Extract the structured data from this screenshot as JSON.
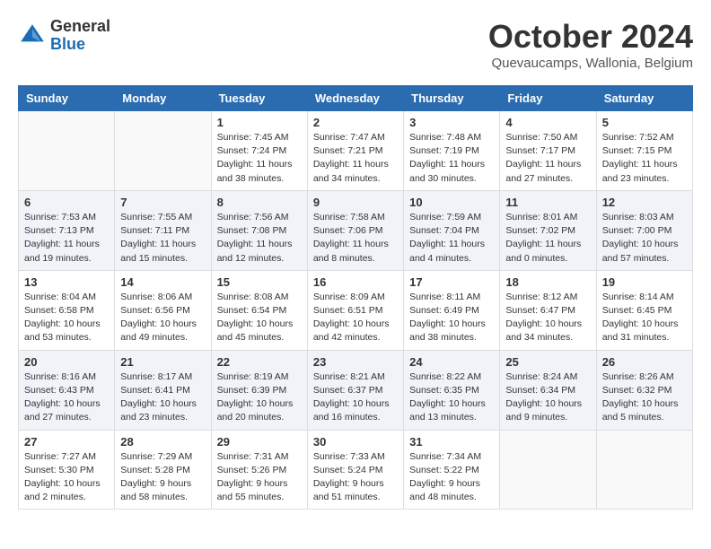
{
  "header": {
    "logo_general": "General",
    "logo_blue": "Blue",
    "month_title": "October 2024",
    "location": "Quevaucamps, Wallonia, Belgium"
  },
  "weekdays": [
    "Sunday",
    "Monday",
    "Tuesday",
    "Wednesday",
    "Thursday",
    "Friday",
    "Saturday"
  ],
  "weeks": [
    {
      "days": [
        {
          "num": "",
          "info": ""
        },
        {
          "num": "",
          "info": ""
        },
        {
          "num": "1",
          "info": "Sunrise: 7:45 AM\nSunset: 7:24 PM\nDaylight: 11 hours and 38 minutes."
        },
        {
          "num": "2",
          "info": "Sunrise: 7:47 AM\nSunset: 7:21 PM\nDaylight: 11 hours and 34 minutes."
        },
        {
          "num": "3",
          "info": "Sunrise: 7:48 AM\nSunset: 7:19 PM\nDaylight: 11 hours and 30 minutes."
        },
        {
          "num": "4",
          "info": "Sunrise: 7:50 AM\nSunset: 7:17 PM\nDaylight: 11 hours and 27 minutes."
        },
        {
          "num": "5",
          "info": "Sunrise: 7:52 AM\nSunset: 7:15 PM\nDaylight: 11 hours and 23 minutes."
        }
      ]
    },
    {
      "days": [
        {
          "num": "6",
          "info": "Sunrise: 7:53 AM\nSunset: 7:13 PM\nDaylight: 11 hours and 19 minutes."
        },
        {
          "num": "7",
          "info": "Sunrise: 7:55 AM\nSunset: 7:11 PM\nDaylight: 11 hours and 15 minutes."
        },
        {
          "num": "8",
          "info": "Sunrise: 7:56 AM\nSunset: 7:08 PM\nDaylight: 11 hours and 12 minutes."
        },
        {
          "num": "9",
          "info": "Sunrise: 7:58 AM\nSunset: 7:06 PM\nDaylight: 11 hours and 8 minutes."
        },
        {
          "num": "10",
          "info": "Sunrise: 7:59 AM\nSunset: 7:04 PM\nDaylight: 11 hours and 4 minutes."
        },
        {
          "num": "11",
          "info": "Sunrise: 8:01 AM\nSunset: 7:02 PM\nDaylight: 11 hours and 0 minutes."
        },
        {
          "num": "12",
          "info": "Sunrise: 8:03 AM\nSunset: 7:00 PM\nDaylight: 10 hours and 57 minutes."
        }
      ]
    },
    {
      "days": [
        {
          "num": "13",
          "info": "Sunrise: 8:04 AM\nSunset: 6:58 PM\nDaylight: 10 hours and 53 minutes."
        },
        {
          "num": "14",
          "info": "Sunrise: 8:06 AM\nSunset: 6:56 PM\nDaylight: 10 hours and 49 minutes."
        },
        {
          "num": "15",
          "info": "Sunrise: 8:08 AM\nSunset: 6:54 PM\nDaylight: 10 hours and 45 minutes."
        },
        {
          "num": "16",
          "info": "Sunrise: 8:09 AM\nSunset: 6:51 PM\nDaylight: 10 hours and 42 minutes."
        },
        {
          "num": "17",
          "info": "Sunrise: 8:11 AM\nSunset: 6:49 PM\nDaylight: 10 hours and 38 minutes."
        },
        {
          "num": "18",
          "info": "Sunrise: 8:12 AM\nSunset: 6:47 PM\nDaylight: 10 hours and 34 minutes."
        },
        {
          "num": "19",
          "info": "Sunrise: 8:14 AM\nSunset: 6:45 PM\nDaylight: 10 hours and 31 minutes."
        }
      ]
    },
    {
      "days": [
        {
          "num": "20",
          "info": "Sunrise: 8:16 AM\nSunset: 6:43 PM\nDaylight: 10 hours and 27 minutes."
        },
        {
          "num": "21",
          "info": "Sunrise: 8:17 AM\nSunset: 6:41 PM\nDaylight: 10 hours and 23 minutes."
        },
        {
          "num": "22",
          "info": "Sunrise: 8:19 AM\nSunset: 6:39 PM\nDaylight: 10 hours and 20 minutes."
        },
        {
          "num": "23",
          "info": "Sunrise: 8:21 AM\nSunset: 6:37 PM\nDaylight: 10 hours and 16 minutes."
        },
        {
          "num": "24",
          "info": "Sunrise: 8:22 AM\nSunset: 6:35 PM\nDaylight: 10 hours and 13 minutes."
        },
        {
          "num": "25",
          "info": "Sunrise: 8:24 AM\nSunset: 6:34 PM\nDaylight: 10 hours and 9 minutes."
        },
        {
          "num": "26",
          "info": "Sunrise: 8:26 AM\nSunset: 6:32 PM\nDaylight: 10 hours and 5 minutes."
        }
      ]
    },
    {
      "days": [
        {
          "num": "27",
          "info": "Sunrise: 7:27 AM\nSunset: 5:30 PM\nDaylight: 10 hours and 2 minutes."
        },
        {
          "num": "28",
          "info": "Sunrise: 7:29 AM\nSunset: 5:28 PM\nDaylight: 9 hours and 58 minutes."
        },
        {
          "num": "29",
          "info": "Sunrise: 7:31 AM\nSunset: 5:26 PM\nDaylight: 9 hours and 55 minutes."
        },
        {
          "num": "30",
          "info": "Sunrise: 7:33 AM\nSunset: 5:24 PM\nDaylight: 9 hours and 51 minutes."
        },
        {
          "num": "31",
          "info": "Sunrise: 7:34 AM\nSunset: 5:22 PM\nDaylight: 9 hours and 48 minutes."
        },
        {
          "num": "",
          "info": ""
        },
        {
          "num": "",
          "info": ""
        }
      ]
    }
  ]
}
